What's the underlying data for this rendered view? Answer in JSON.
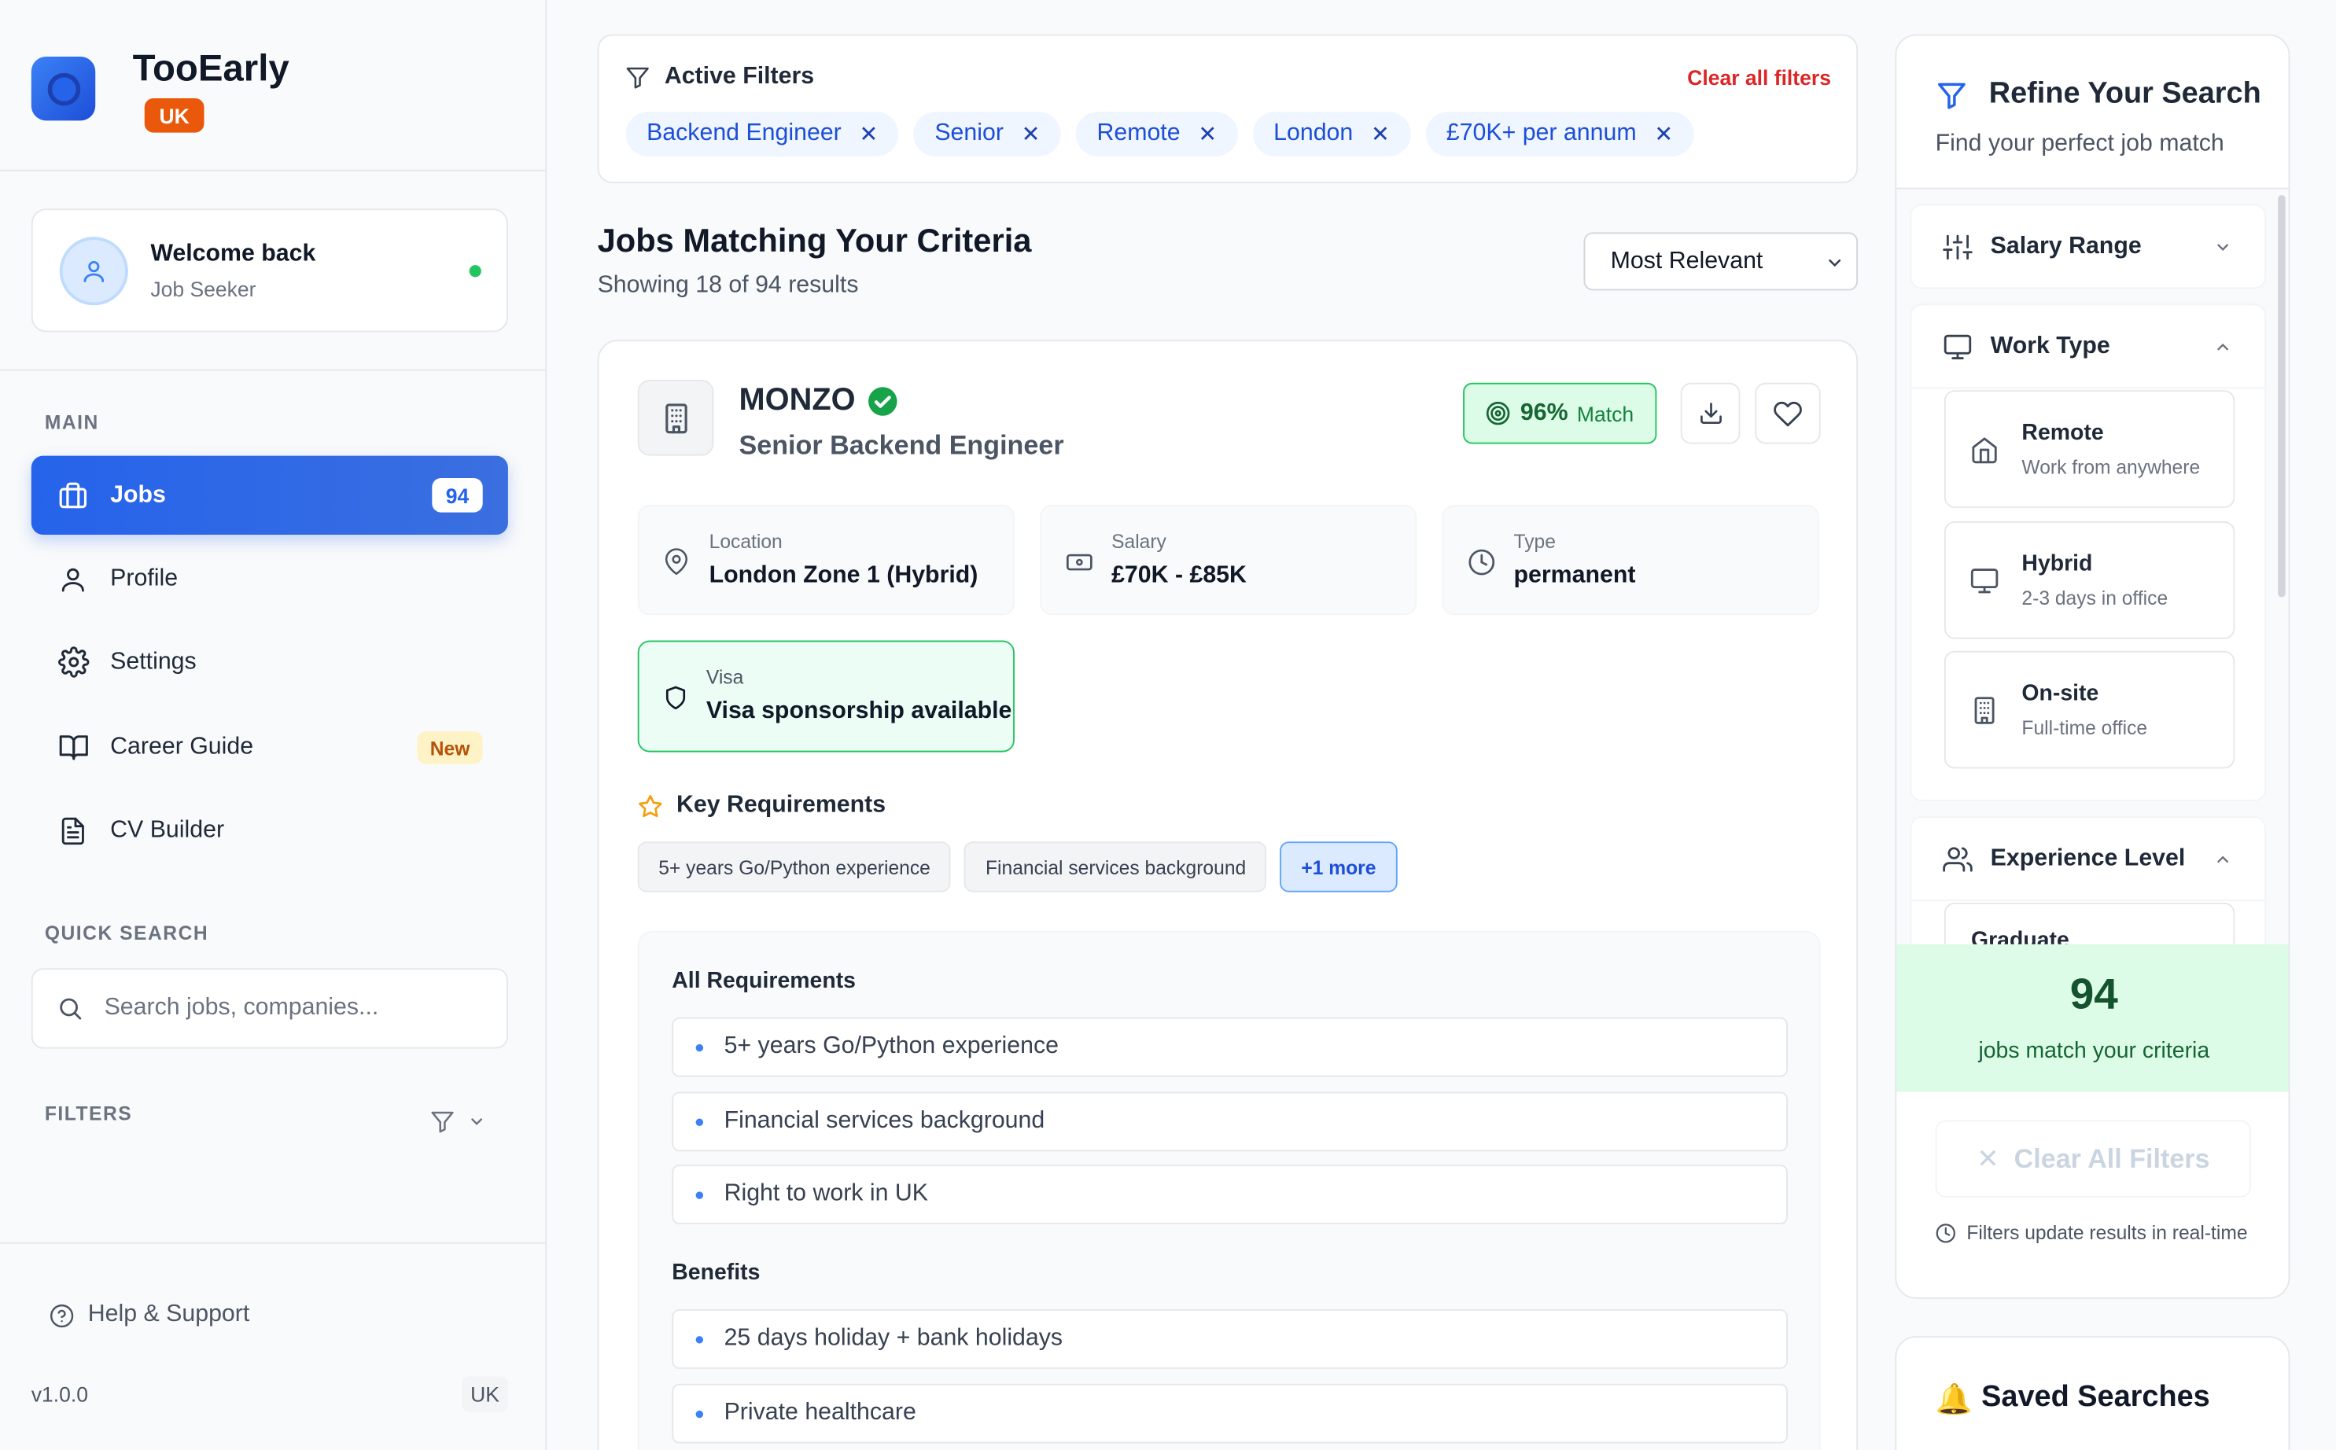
{
  "app": {
    "name": "TooEarly",
    "region_badge": "UK",
    "version": "v1.0.0",
    "locale": "UK"
  },
  "user": {
    "greeting": "Welcome back",
    "role": "Job Seeker",
    "status_color": "#22c55e"
  },
  "sidebar": {
    "main_label": "MAIN",
    "items": [
      {
        "label": "Jobs",
        "icon": "briefcase-icon",
        "count": "94",
        "active": true
      },
      {
        "label": "Profile",
        "icon": "user-icon"
      },
      {
        "label": "Settings",
        "icon": "gear-icon"
      },
      {
        "label": "Career Guide",
        "icon": "book-icon",
        "badge": "New"
      },
      {
        "label": "CV Builder",
        "icon": "document-icon"
      }
    ],
    "quick_search_label": "QUICK SEARCH",
    "search_placeholder": "Search jobs, companies...",
    "filters_label": "FILTERS",
    "help_label": "Help & Support"
  },
  "active_filters": {
    "title": "Active Filters",
    "clear_label": "Clear all filters",
    "chips": [
      "Backend Engineer",
      "Senior",
      "Remote",
      "London",
      "£70K+ per annum"
    ]
  },
  "results": {
    "title": "Jobs Matching Your Criteria",
    "summary": "Showing 18 of 94 results",
    "sort_selected": "Most Relevant"
  },
  "job": {
    "company": "MONZO",
    "verified": true,
    "title": "Senior Backend Engineer",
    "match_pct": "96%",
    "match_label": "Match",
    "location_label": "Location",
    "location": "London Zone 1 (Hybrid)",
    "salary_label": "Salary",
    "salary": "£70K - £85K",
    "type_label": "Type",
    "type": "permanent",
    "visa_label": "Visa",
    "visa": "Visa sponsorship available",
    "key_req_title": "Key Requirements",
    "key_tags": [
      "5+ years Go/Python experience",
      "Financial services background"
    ],
    "more_tag": "+1 more",
    "all_req_title": "All Requirements",
    "requirements": [
      "5+ years Go/Python experience",
      "Financial services background",
      "Right to work in UK"
    ],
    "benefits_title": "Benefits",
    "benefits": [
      "25 days holiday + bank holidays",
      "Private healthcare"
    ]
  },
  "refine": {
    "title": "Refine Your Search",
    "subtitle": "Find your perfect job match",
    "salary_range_label": "Salary Range",
    "work_type_label": "Work Type",
    "work_types": [
      {
        "title": "Remote",
        "sub": "Work from anywhere",
        "icon": "home-icon"
      },
      {
        "title": "Hybrid",
        "sub": "2-3 days in office",
        "icon": "monitor-icon"
      },
      {
        "title": "On-site",
        "sub": "Full-time office",
        "icon": "building-icon"
      }
    ],
    "experience_label": "Experience Level",
    "experience_levels": [
      "Graduate"
    ],
    "match_count": "94",
    "match_text": "jobs match your criteria",
    "clear_all_label": "Clear All Filters",
    "realtime_note": "Filters update results in real-time"
  },
  "saved_searches": {
    "title": "Saved Searches",
    "icon": "bell-icon"
  },
  "colors": {
    "primary": "#2563eb",
    "success": "#22c55e",
    "danger": "#dc2626",
    "warning": "#ea580c"
  }
}
